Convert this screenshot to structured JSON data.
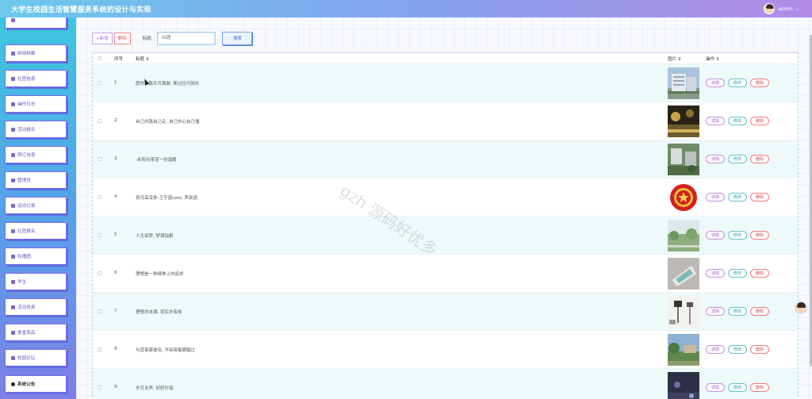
{
  "header": {
    "title": "大学生校园生活智慧服务系统的设计与实现",
    "user": "admin"
  },
  "sidebar": {
    "items": [
      {
        "label": ""
      },
      {
        "label": "新闻档案"
      },
      {
        "label": "社团信息"
      },
      {
        "label": "操作日志"
      },
      {
        "label": "活动报名"
      },
      {
        "label": "预订信息"
      },
      {
        "label": "管理员"
      },
      {
        "label": "运动记录"
      },
      {
        "label": "社团报名"
      },
      {
        "label": "轮播图"
      },
      {
        "label": "学生"
      },
      {
        "label": "活动信息"
      },
      {
        "label": "食堂菜品"
      },
      {
        "label": "校园论坛"
      },
      {
        "label": "系统公告"
      }
    ]
  },
  "toolbar": {
    "add_label": "+新增",
    "delete_label": "删除",
    "keyword_label": "标题:",
    "keyword_placeholder": "标题",
    "search_label": "搜索"
  },
  "table": {
    "columns": {
      "index": "序号",
      "title": "标题 ⇕",
      "image": "图片 ⇕",
      "actions": "操作 ⇕"
    },
    "actions": {
      "detail": "详情",
      "edit": "修改",
      "remove": "删除"
    },
    "rows": [
      {
        "index": "1",
        "title": "愿你一路天可爽歇, 斯过往可回头"
      },
      {
        "index": "2",
        "title": "自己的路自己走, 自己的心自己懂"
      },
      {
        "index": "3",
        "title": "-米阳光带道一份温暖"
      },
      {
        "index": "4",
        "title": "青月高没条-王字宙Leto, 养浚逃"
      },
      {
        "index": "5",
        "title": "人生如梦, 梦境指帆"
      },
      {
        "index": "6",
        "title": "理想是一种精神上的追求"
      },
      {
        "index": "7",
        "title": "理想亦未满, 现实亦有依"
      },
      {
        "index": "8",
        "title": "与其羡慕彼岛, 不如带着脚踏过"
      },
      {
        "index": "9",
        "title": "岁月无声, 好好珍惜"
      }
    ]
  },
  "watermark": "gzh 源码好优多"
}
